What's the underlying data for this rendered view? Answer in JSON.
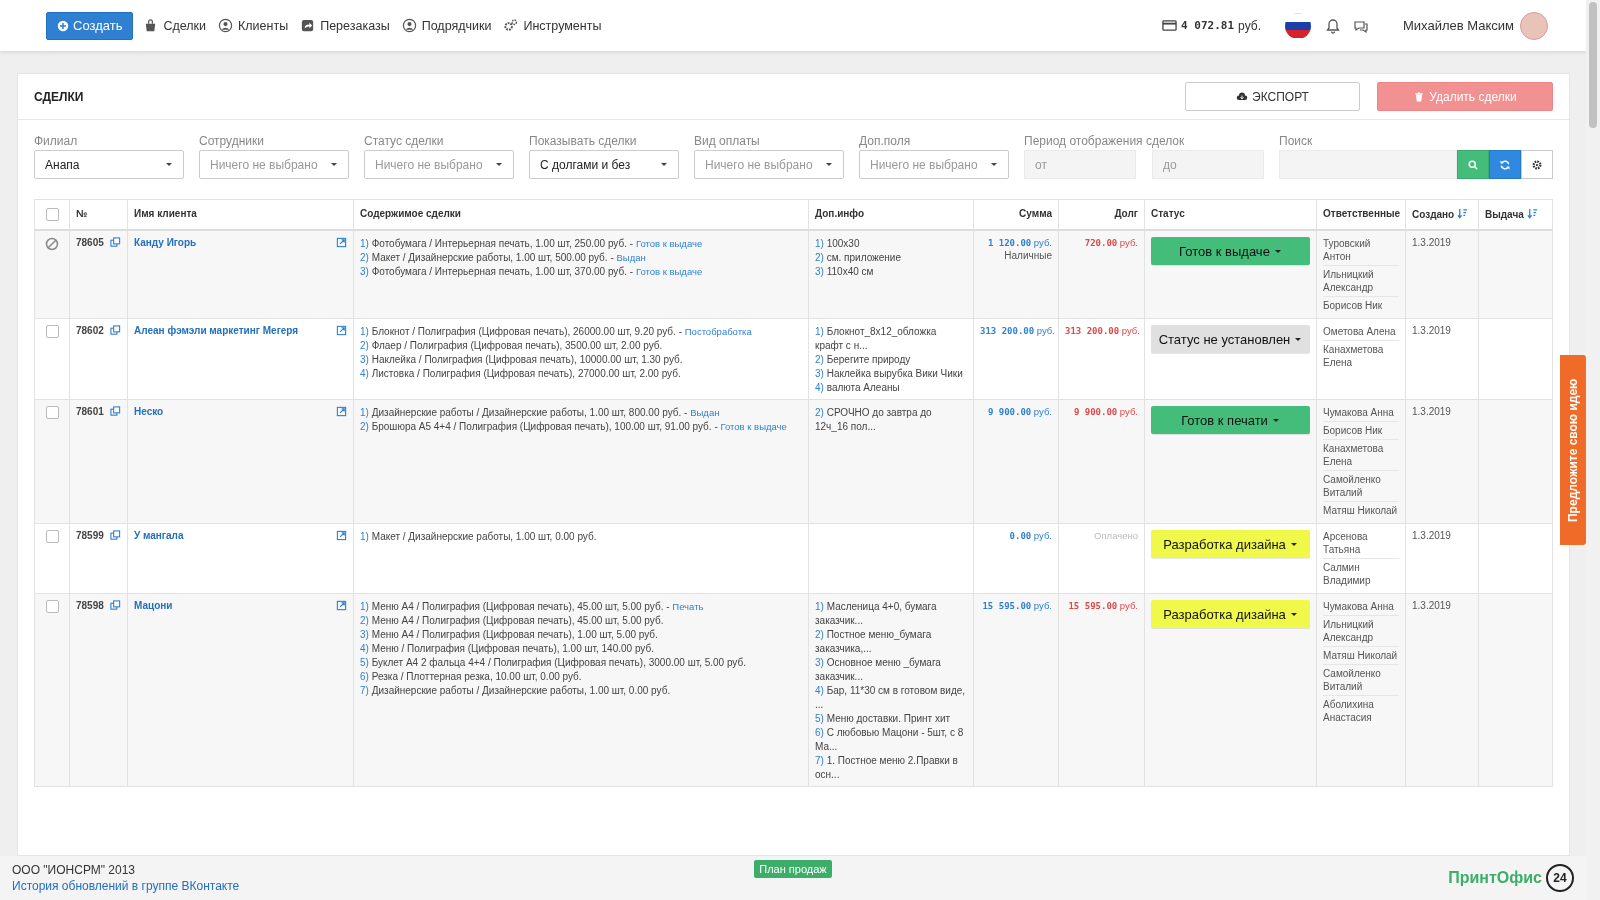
{
  "nav": {
    "create_button": "Создать",
    "items": [
      {
        "label": "Сделки"
      },
      {
        "label": "Клиенты"
      },
      {
        "label": "Перезаказы"
      },
      {
        "label": "Подрядчики"
      },
      {
        "label": "Инструменты"
      }
    ],
    "balance": "4 072.81",
    "balance_unit": "руб.",
    "user_name": "Михайлев Максим"
  },
  "page": {
    "title": "СДЕЛКИ",
    "export_button": "ЭКСПОРТ",
    "delete_button": "Удалить сделки"
  },
  "filters": [
    {
      "kind": "select",
      "label": "Филиал",
      "value": "Анапа"
    },
    {
      "kind": "select",
      "label": "Сотрудники",
      "placeholder": "Ничего не выбрано"
    },
    {
      "kind": "select",
      "label": "Статус сделки",
      "placeholder": "Ничего не выбрано"
    },
    {
      "kind": "select",
      "label": "Показывать сделки",
      "value": "С долгами и без"
    },
    {
      "kind": "select",
      "label": "Вид оплаты",
      "placeholder": "Ничего не выбрано"
    },
    {
      "kind": "select",
      "label": "Доп.поля",
      "placeholder": "Ничего не выбрано"
    },
    {
      "kind": "range",
      "label": "Период отображения сделок",
      "from_placeholder": "от",
      "to_placeholder": "до"
    },
    {
      "kind": "search",
      "label": "Поиск"
    }
  ],
  "table": {
    "select_all_checked": false,
    "columns": [
      {
        "label": "№",
        "sortable": false
      },
      {
        "label": "Имя клиента",
        "sortable": false
      },
      {
        "label": "Содержимое сделки",
        "sortable": false
      },
      {
        "label": "Доп.инфо",
        "sortable": false
      },
      {
        "label": "Сумма",
        "sortable": false
      },
      {
        "label": "Долг",
        "sortable": false
      },
      {
        "label": "Статус",
        "sortable": false
      },
      {
        "label": "Ответственные",
        "sortable": false
      },
      {
        "label": "Создано",
        "sortable": true
      },
      {
        "label": "Выдача",
        "sortable": true
      }
    ],
    "rows": [
      {
        "blocked": true,
        "checked": false,
        "number": "78605",
        "client": "Канду Игорь",
        "items": [
          {
            "num": "1)",
            "text": "Фотобумага / Интерьерная печать, 1.00 шт, 250.00 руб. -",
            "status": "Готов к выдаче"
          },
          {
            "num": "2)",
            "text": "Макет / Дизайнерские работы, 1.00 шт, 500.00 руб. -",
            "status": "Выдан"
          },
          {
            "num": "3)",
            "text": "Фотобумага / Интерьерная печать, 1.00 шт, 370.00 руб. -",
            "status": "Готов к выдаче"
          }
        ],
        "info": [
          {
            "num": "1)",
            "text": "100x30"
          },
          {
            "num": "2)",
            "text": "см. приложение"
          },
          {
            "num": "3)",
            "text": "110x40 см"
          }
        ],
        "sum": "1 120.00",
        "sum_unit": "руб.",
        "payment": "Наличные",
        "debt": "720.00",
        "debt_unit": "руб.",
        "paid": false,
        "status": {
          "label": "Готов к выдаче",
          "color": "#45bd7a"
        },
        "responsible": [
          "Туровский Антон",
          "Ильницкий Александр",
          "Борисов Ник"
        ],
        "created": "1.3.2019"
      },
      {
        "blocked": false,
        "checked": false,
        "number": "78602",
        "client": "Алеан фэмэли маркетинг Мегеря",
        "items": [
          {
            "num": "1)",
            "text": "Блокнот / Полиграфия (Цифровая печать), 26000.00 шт, 9.20 руб. -",
            "status": "Постобработка"
          },
          {
            "num": "2)",
            "text": "Флаер / Полиграфия (Цифровая печать), 3500.00 шт, 2.00 руб."
          },
          {
            "num": "3)",
            "text": "Наклейка / Полиграфия (Цифровая печать), 10000.00 шт, 1.30 руб."
          },
          {
            "num": "4)",
            "text": "Листовка / Полиграфия (Цифровая печать), 27000.00 шт, 2.00 руб."
          }
        ],
        "info": [
          {
            "num": "1)",
            "text": "Блокнот_8x12_обложка крафт с н..."
          },
          {
            "num": "2)",
            "text": "Берегите природу"
          },
          {
            "num": "3)",
            "text": "Наклейка вырубка Вики Чики"
          },
          {
            "num": "4)",
            "text": "валюта Алеаны"
          }
        ],
        "sum": "313 200.00",
        "sum_unit": "руб.",
        "debt": "313 200.00",
        "debt_unit": "руб.",
        "paid": false,
        "status": {
          "label": "Статус не установлен",
          "color": "#e0e0e0"
        },
        "responsible": [
          "Ометова Алена",
          "Канахметова Елена"
        ],
        "created": "1.3.2019"
      },
      {
        "blocked": false,
        "checked": false,
        "number": "78601",
        "client": "Неско",
        "items": [
          {
            "num": "1)",
            "text": "Дизайнерские работы / Дизайнерские работы, 1.00 шт, 800.00 руб. -",
            "status": "Выдан"
          },
          {
            "num": "2)",
            "text": "Брошюра А5 4+4 / Полиграфия (Цифровая печать), 100.00 шт, 91.00 руб. -",
            "status": "Готов к выдаче"
          }
        ],
        "info": [
          {
            "num": "2)",
            "text": "СРОЧНО до завтра до 12ч_16 пол..."
          }
        ],
        "sum": "9 900.00",
        "sum_unit": "руб.",
        "debt": "9 900.00",
        "debt_unit": "руб.",
        "paid": false,
        "status": {
          "label": "Готов к печати",
          "color": "#45bd7a"
        },
        "responsible": [
          "Чумакова Анна",
          "Борисов Ник",
          "Канахметова Елена",
          "Самойленко Виталий",
          "Матяш Николай"
        ],
        "created": "1.3.2019"
      },
      {
        "blocked": false,
        "checked": false,
        "number": "78599",
        "client": "У мангала",
        "items": [
          {
            "num": "1)",
            "text": "Макет / Дизайнерские работы, 1.00 шт, 0.00 руб."
          }
        ],
        "info": [],
        "sum": "0.00",
        "sum_unit": "руб.",
        "paid": true,
        "paid_label": "Оплачено",
        "status": {
          "label": "Разработка дизайна",
          "color": "#f0f84a"
        },
        "responsible": [
          "Арсенова Татьяна",
          "Салмин Владимир"
        ],
        "created": "1.3.2019"
      },
      {
        "blocked": false,
        "checked": false,
        "number": "78598",
        "client": "Мацони",
        "items": [
          {
            "num": "1)",
            "text": "Меню А4 / Полиграфия (Цифровая печать), 45.00 шт, 5.00 руб. -",
            "status": "Печать"
          },
          {
            "num": "2)",
            "text": "Меню А4 / Полиграфия (Цифровая печать), 45.00 шт, 5.00 руб."
          },
          {
            "num": "3)",
            "text": "Меню А4 / Полиграфия (Цифровая печать), 1.00 шт, 5.00 руб."
          },
          {
            "num": "4)",
            "text": "Меню / Полиграфия (Цифровая печать), 1.00 шт, 140.00 руб."
          },
          {
            "num": "5)",
            "text": "Буклет А4 2 фальца 4+4 / Полиграфия (Цифровая печать), 3000.00 шт, 5.00 руб."
          },
          {
            "num": "6)",
            "text": "Резка / Плоттерная резка, 10.00 шт, 0.00 руб."
          },
          {
            "num": "7)",
            "text": "Дизайнерские работы / Дизайнерские работы, 1.00 шт, 0.00 руб."
          }
        ],
        "info": [
          {
            "num": "1)",
            "text": "Масленица 4+0, бумага заказчик..."
          },
          {
            "num": "2)",
            "text": "Постное меню_бумага заказчика,..."
          },
          {
            "num": "3)",
            "text": "Основное меню _бумага заказчик..."
          },
          {
            "num": "4)",
            "text": "Бар, 11*30 см в готовом виде, ..."
          },
          {
            "num": "5)",
            "text": "Меню доставки. Принт хит"
          },
          {
            "num": "6)",
            "text": "С любовью Мацони - 5шт, с 8 Ма..."
          },
          {
            "num": "7)",
            "text": "1. Постное меню 2.Правки в осн..."
          }
        ],
        "sum": "15 595.00",
        "sum_unit": "руб.",
        "debt": "15 595.00",
        "debt_unit": "руб.",
        "paid": false,
        "status": {
          "label": "Разработка дизайна",
          "color": "#f0f84a"
        },
        "responsible": [
          "Чумакова Анна",
          "Ильницкий Александр",
          "Матяш Николай",
          "Самойленко Виталий",
          "Аболихина Анастасия"
        ],
        "created": "1.3.2019"
      }
    ]
  },
  "side_tab": "Предложите свою идею",
  "footer": {
    "company": "ООО \"ИОНСРМ\" 2013",
    "link": "История обновлений в группе ВКонтакте",
    "plan_button": "План продаж",
    "brand": "ПринтОфис",
    "brand_badge": "24"
  }
}
